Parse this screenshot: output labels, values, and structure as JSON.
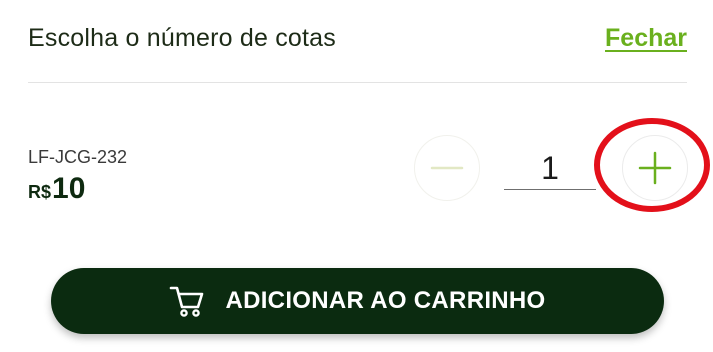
{
  "header": {
    "title": "Escolha o número de cotas",
    "close_label": "Fechar"
  },
  "product": {
    "code": "LF-JCG-232",
    "currency": "R$",
    "price": "10"
  },
  "quantity": {
    "value": "1",
    "decrement_icon": "minus-icon",
    "increment_icon": "plus-icon"
  },
  "cart_button": {
    "label": "ADICIONAR AO CARRINHO",
    "icon": "cart-icon"
  },
  "colors": {
    "accent_green": "#6ab01e",
    "dark_green": "#0b2b10",
    "highlight_red": "#e3101a"
  }
}
